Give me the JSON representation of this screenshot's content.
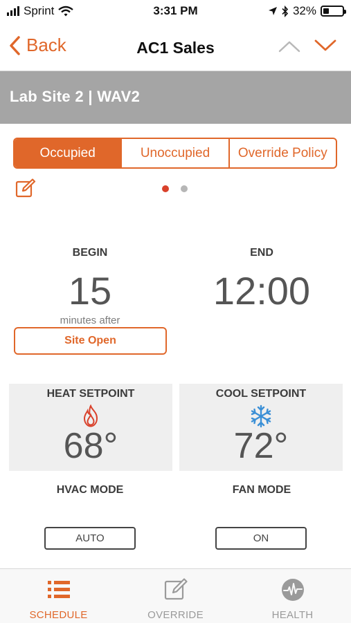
{
  "status_bar": {
    "carrier": "Sprint",
    "time": "3:31 PM",
    "battery": "32%",
    "battery_level": 0.32
  },
  "nav": {
    "back_label": "Back",
    "title": "AC1 Sales"
  },
  "site": {
    "title": "Lab Site 2 | WAV2"
  },
  "schedule_tabs": [
    {
      "label": "Occupied",
      "active": true
    },
    {
      "label": "Unoccupied",
      "active": false
    },
    {
      "label": "Override Policy",
      "active": false
    }
  ],
  "pager": {
    "pages": 2,
    "current": 1
  },
  "schedule": {
    "begin_label": "BEGIN",
    "begin_value": "15",
    "begin_sub": "minutes after",
    "begin_reference": "Site Open",
    "end_label": "END",
    "end_value": "12:00"
  },
  "setpoints": {
    "heat_label": "HEAT SETPOINT",
    "heat_value": "68°",
    "cool_label": "COOL SETPOINT",
    "cool_value": "72°"
  },
  "modes": {
    "hvac_label": "HVAC MODE",
    "hvac_value": "AUTO",
    "fan_label": "FAN MODE",
    "fan_value": "ON"
  },
  "tabbar": [
    {
      "label": "SCHEDULE",
      "icon": "list-icon",
      "active": true
    },
    {
      "label": "OVERRIDE",
      "icon": "edit-icon",
      "active": false
    },
    {
      "label": "HEALTH",
      "icon": "heartbeat-icon",
      "active": false
    }
  ],
  "colors": {
    "accent": "#e0672a",
    "header_gray": "#a5a5a5",
    "heat_red": "#d9412b",
    "cool_blue": "#3a8fd6"
  }
}
